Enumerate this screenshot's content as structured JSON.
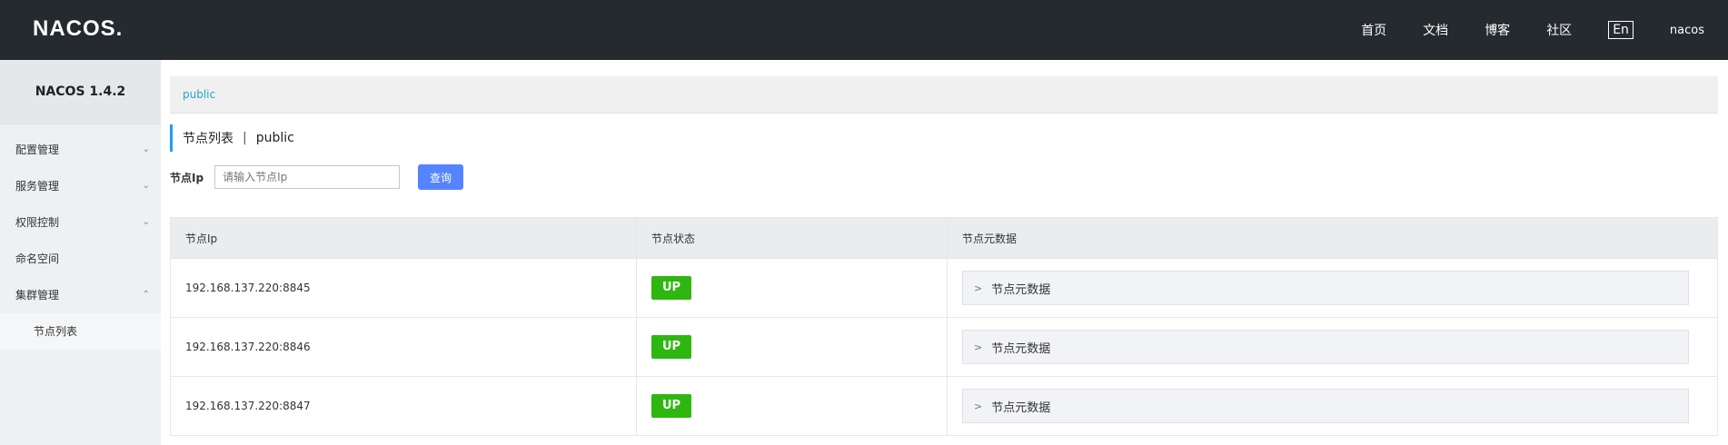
{
  "header": {
    "logo": "NACOS.",
    "nav": [
      "首页",
      "文档",
      "博客",
      "社区"
    ],
    "lang": "En",
    "user": "nacos"
  },
  "sidebar": {
    "version": "NACOS 1.4.2",
    "items": [
      {
        "label": "配置管理",
        "chevron": "⌄"
      },
      {
        "label": "服务管理",
        "chevron": "⌄"
      },
      {
        "label": "权限控制",
        "chevron": "⌄"
      },
      {
        "label": "命名空间",
        "chevron": ""
      },
      {
        "label": "集群管理",
        "chevron": "⌃"
      }
    ],
    "sub_items": [
      "节点列表"
    ]
  },
  "main": {
    "breadcrumb": "public",
    "title": "节点列表",
    "title_sep": "|",
    "namespace": "public",
    "search": {
      "label": "节点Ip",
      "placeholder": "请输入节点Ip",
      "button": "查询"
    },
    "table": {
      "headers": [
        "节点Ip",
        "节点状态",
        "节点元数据"
      ],
      "rows": [
        {
          "ip": "192.168.137.220:8845",
          "status": "UP",
          "meta": "节点元数据"
        },
        {
          "ip": "192.168.137.220:8846",
          "status": "UP",
          "meta": "节点元数据"
        },
        {
          "ip": "192.168.137.220:8847",
          "status": "UP",
          "meta": "节点元数据"
        }
      ]
    }
  },
  "colors": {
    "topbar": "#252a2f",
    "accent": "#5584ff",
    "status_up": "#2fb711",
    "link": "#21a8ce"
  }
}
